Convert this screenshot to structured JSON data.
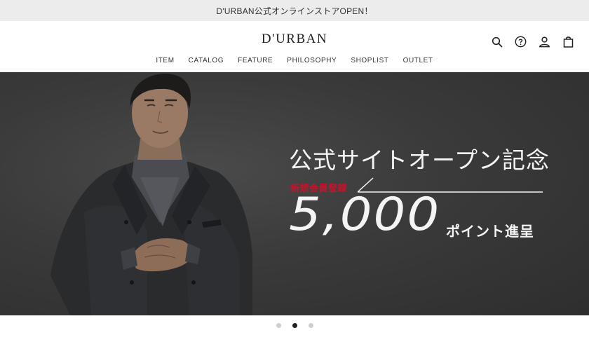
{
  "announcement": "D'URBAN公式オンラインストアOPEN！",
  "logo": "D'URBAN",
  "header_icons": [
    "search-icon",
    "help-icon",
    "account-icon",
    "cart-icon"
  ],
  "nav": {
    "items": [
      {
        "label": "ITEM"
      },
      {
        "label": "CATALOG"
      },
      {
        "label": "FEATURE"
      },
      {
        "label": "PHILOSOPHY"
      },
      {
        "label": "SHOPLIST"
      },
      {
        "label": "OUTLET"
      }
    ]
  },
  "hero": {
    "headline": "公式サイトオープン記念",
    "member_tag": "新規会員登録",
    "points_number": "5,000",
    "points_label": "ポイント進呈",
    "accent_color": "#c8122a"
  },
  "carousel": {
    "slide_count": 3,
    "active_index": 1
  }
}
